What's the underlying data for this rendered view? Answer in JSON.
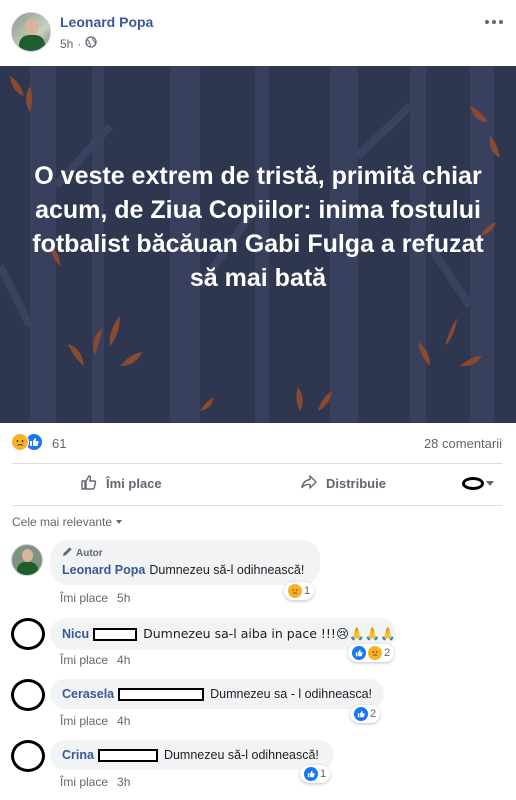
{
  "post": {
    "author": "Leonard Popa",
    "time": "5h",
    "image_text": "O veste extrem de tristă, primită chiar acum, de Ziua Copiilor: inima fostului fotbalist băcăuan Gabi Fulga a refuzat să mai bată"
  },
  "stats": {
    "reactions": "61",
    "comments": "28 comentarii"
  },
  "actions": {
    "like": "Îmi place",
    "share": "Distribuie"
  },
  "sort_label": "Cele mai relevante",
  "comments": [
    {
      "badge": "Autor",
      "author": "Leonard Popa",
      "text": "Dumnezeu să-l odihnească!",
      "like": "Îmi place",
      "time": "5h",
      "reactions": "1"
    },
    {
      "author": "Nicu",
      "text": "Dumnezeu sa-l aiba in pace !!!😢🙏🙏🙏",
      "like": "Îmi place",
      "time": "4h",
      "reactions": "2"
    },
    {
      "author": "Cerasela",
      "text": "Dumnezeu sa - l odihneasca!",
      "like": "Îmi place",
      "time": "4h",
      "reactions": "2"
    },
    {
      "author": "Crina",
      "text": "Dumnezeu să-l odihnească!",
      "like": "Îmi place",
      "time": "3h",
      "reactions": "1"
    }
  ],
  "colors": {
    "link": "#385898",
    "image_bg": "#2f3650",
    "like_blue": "#1877f2",
    "sad_yellow": "#f7b125",
    "leaf": "#8a4a2e"
  },
  "icons": [
    "globe-icon",
    "more-dots-icon",
    "thumbs-up-icon",
    "share-arrow-icon",
    "pencil-icon",
    "sad-reaction-icon",
    "like-reaction-icon",
    "caret-down-icon"
  ]
}
